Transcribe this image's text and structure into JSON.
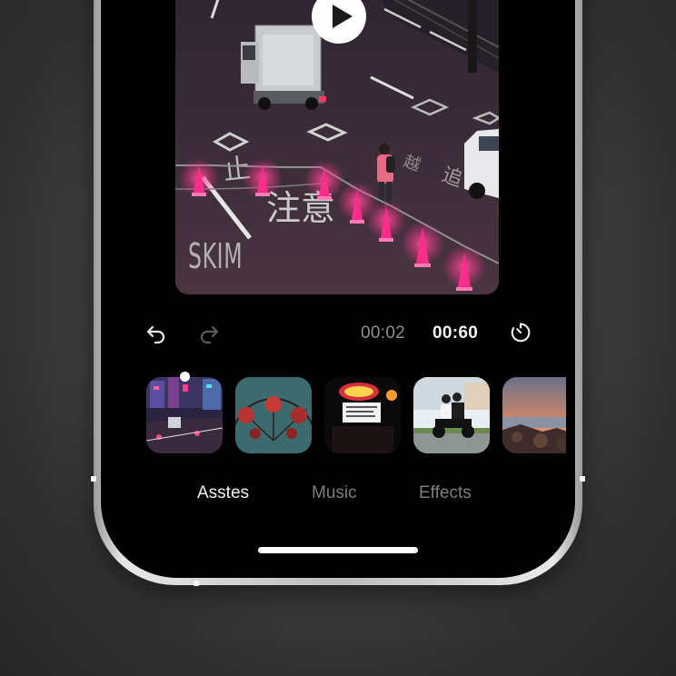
{
  "preview": {
    "watermark": "SKIM",
    "road_text": "注意"
  },
  "player": {
    "current_time": "00:02",
    "total_time": "00:60"
  },
  "thumbnails": [
    {
      "name": "city-night-street"
    },
    {
      "name": "ferris-wheel"
    },
    {
      "name": "neon-sign-night"
    },
    {
      "name": "scooter-riders"
    },
    {
      "name": "sunset-coast"
    }
  ],
  "tabs": {
    "assets": "Asstes",
    "music": "Music",
    "effects": "Effects"
  },
  "colors": {
    "background": "#000000",
    "active_text": "#f2f2f2",
    "inactive_text": "#7d7d7d",
    "neon_pink": "#ff2d8a"
  }
}
